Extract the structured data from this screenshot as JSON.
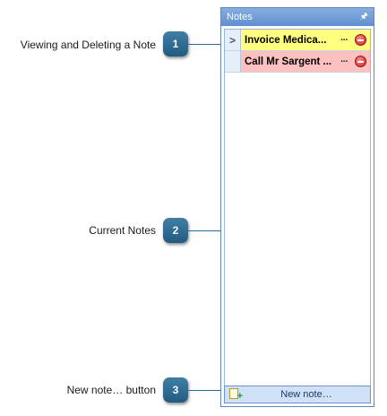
{
  "callouts": [
    {
      "number": "1",
      "label": "Viewing and Deleting a Note"
    },
    {
      "number": "2",
      "label": "Current Notes"
    },
    {
      "number": "3",
      "label": "New note… button"
    }
  ],
  "panel": {
    "title": "Notes",
    "pin_icon": "pin-icon",
    "notes": [
      {
        "title": "Invoice Medica...",
        "color": "#ffff80",
        "selected": true,
        "selector_glyph": ">",
        "action_label": "···"
      },
      {
        "title": "Call Mr Sargent ...",
        "color": "#ffc0c0",
        "selected": false,
        "selector_glyph": "",
        "action_label": "···"
      }
    ],
    "new_note_button": {
      "label": "New note…",
      "icon": "new-note-icon"
    }
  },
  "colors": {
    "badge": "#2f6e98",
    "header": "#6f9ad6",
    "note_yellow": "#ffff80",
    "note_red": "#ffc0c0"
  }
}
